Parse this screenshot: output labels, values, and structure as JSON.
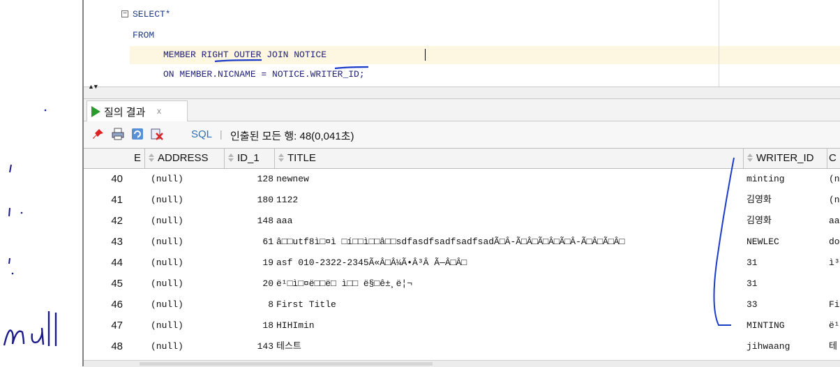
{
  "editor": {
    "lines": [
      "SELECT*",
      "FROM",
      "MEMBER RIGHT OUTER JOIN NOTICE",
      "ON MEMBER.NICNAME = NOTICE.WRITER_ID;"
    ]
  },
  "result_tab": {
    "label": "질의 결과",
    "close": "x"
  },
  "toolbar": {
    "sql_label": "SQL",
    "separator": "|",
    "status": "인출된 모든 행: 48(0,041초)",
    "icons": [
      "pin-icon",
      "print-icon",
      "refresh-icon",
      "cancel-query-icon"
    ]
  },
  "grid": {
    "columns": [
      {
        "label": "E",
        "sortable": false
      },
      {
        "label": "ADDRESS",
        "sortable": true
      },
      {
        "label": "ID_1",
        "sortable": true
      },
      {
        "label": "TITLE",
        "sortable": true
      },
      {
        "label": "WRITER_ID",
        "sortable": true
      },
      {
        "label": "C",
        "sortable": false
      }
    ],
    "rows": [
      {
        "n": "40",
        "address": "(null)",
        "id": "128",
        "title": "newnew",
        "writer": "minting",
        "c": "(n"
      },
      {
        "n": "41",
        "address": "(null)",
        "id": "180",
        "title": "1122",
        "writer": "김영화",
        "c": "(n"
      },
      {
        "n": "42",
        "address": "(null)",
        "id": "148",
        "title": "aaa",
        "writer": "김영화",
        "c": "aa"
      },
      {
        "n": "43",
        "address": "(null)",
        "id": "61",
        "title": "â□□utf8ì□¤ì □í□□ì□□â□□sdfasdfsadfsadfsadÃ□Â-Ã□Â□Ã□Â□Ã□Â-Ã□Â□Ã□Â□",
        "writer": "NEWLEC",
        "c": "do"
      },
      {
        "n": "44",
        "address": "(null)",
        "id": "19",
        "title": "asf 010-2322-2345Ã«Â□Â¼Ã•Â³Â Ã—Â□Â□",
        "writer": "31",
        "c": "ì³"
      },
      {
        "n": "45",
        "address": "(null)",
        "id": "20",
        "title": "ë¹□ì□¤ë□□ë□ ì□□ ë§□ê±¸ë¦¬",
        "writer": "31",
        "c": ""
      },
      {
        "n": "46",
        "address": "(null)",
        "id": "8",
        "title": "First Title",
        "writer": "33",
        "c": "Fi"
      },
      {
        "n": "47",
        "address": "(null)",
        "id": "18",
        "title": "HIHImin",
        "writer": "MINTING",
        "c": "ë¹"
      },
      {
        "n": "48",
        "address": "(null)",
        "id": "143",
        "title": "테스트",
        "writer": "jihwaang",
        "c": "테"
      }
    ]
  },
  "annotations": {
    "handwritten_margin": "null"
  }
}
